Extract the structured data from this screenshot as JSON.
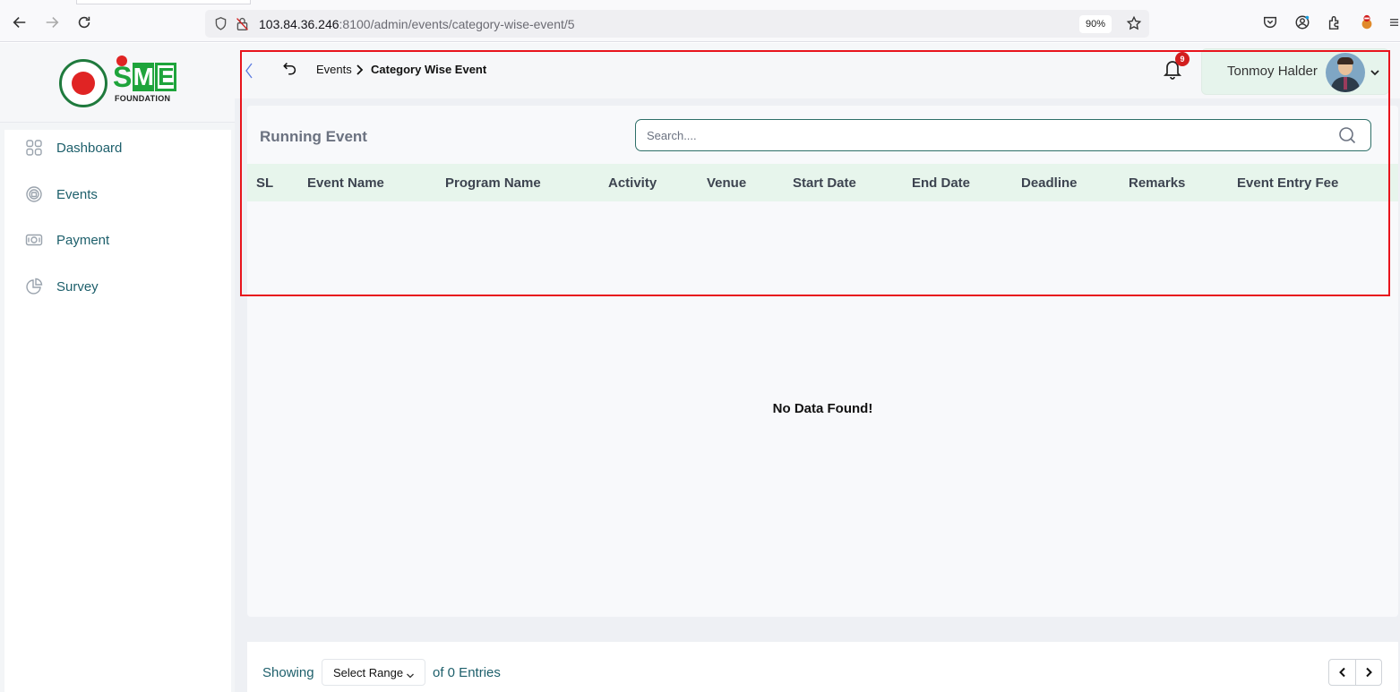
{
  "browser": {
    "url_host": "103.84.36.246",
    "url_rest": ":8100/admin/events/category-wise-event/5",
    "zoom": "90%",
    "icons": [
      "back-arrow-icon",
      "forward-arrow-icon",
      "reload-icon",
      "shield-icon",
      "insecure-lock-icon",
      "bookmark-star-icon",
      "pocket-icon",
      "account-icon",
      "extensions-icon",
      "profile-icon",
      "menu-icon"
    ]
  },
  "sidebar": {
    "logo": {
      "sme": "SME",
      "foundation": "FOUNDATION"
    },
    "items": [
      {
        "label": "Dashboard",
        "icon": "grid-icon"
      },
      {
        "label": "Events",
        "icon": "events-icon"
      },
      {
        "label": "Payment",
        "icon": "payment-icon"
      },
      {
        "label": "Survey",
        "icon": "pie-chart-icon"
      }
    ]
  },
  "topbar": {
    "breadcrumb": {
      "parent": "Events",
      "current": "Category Wise Event"
    },
    "notification_count": "9",
    "user_name": "Tonmoy Halder"
  },
  "content": {
    "title": "Running Event",
    "search_placeholder": "Search....",
    "columns": [
      "SL",
      "Event Name",
      "Program Name",
      "Activity",
      "Venue",
      "Start Date",
      "End Date",
      "Deadline",
      "Remarks",
      "Event Entry Fee"
    ],
    "rows": [],
    "empty_message": "No Data Found!"
  },
  "footer": {
    "showing": "Showing",
    "range_select": "Select Range",
    "entries_text": "of 0 Entries"
  },
  "colors": {
    "accent_teal": "#1d5f6b",
    "table_header_bg": "#e7f5ec",
    "highlight_red": "#e8141c",
    "badge_red": "#d21e1e"
  }
}
